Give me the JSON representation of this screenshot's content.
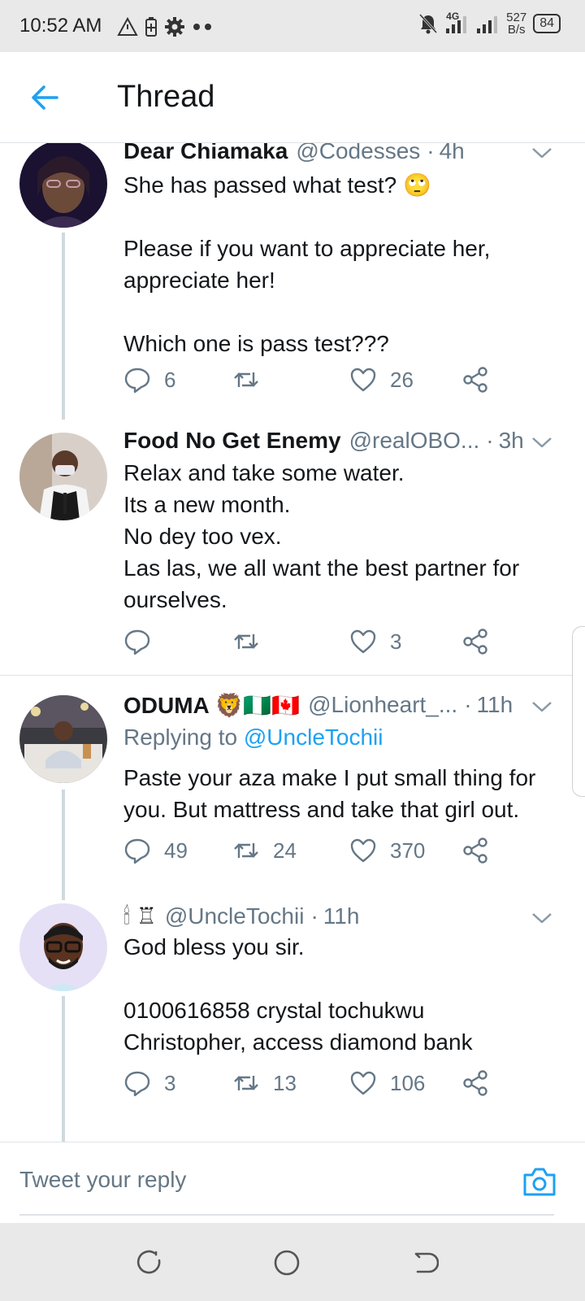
{
  "status_bar": {
    "time": "10:52 AM",
    "left_icons": [
      "alert-triangle-icon",
      "battery-saver-icon",
      "gear-icon",
      "dots-icon"
    ],
    "network": "4G",
    "speed_value": "527",
    "speed_unit": "B/s",
    "battery": "84"
  },
  "header": {
    "title": "Thread",
    "back_icon": "arrow-left-icon"
  },
  "tweets": [
    {
      "name": "Dear Chiamaka",
      "handle": "@Codesses",
      "time": "4h",
      "reply_to": "",
      "lines": [
        "She has passed what test? 🙄",
        "",
        "Please if you want to appreciate her,",
        "appreciate her!",
        "",
        "Which one is pass test???"
      ],
      "replies": "6",
      "retweets": "",
      "likes": "26"
    },
    {
      "name": "Food No Get Enemy",
      "handle": "@realOBO...",
      "time": "3h",
      "reply_to": "",
      "lines": [
        "Relax and take some water.",
        "Its a new month.",
        "No dey too vex.",
        "Las las, we all want the best partner for",
        "ourselves."
      ],
      "replies": "",
      "retweets": "",
      "likes": "3"
    },
    {
      "name": "ODUMA 🦁🇳🇬🇨🇦",
      "handle": "@Lionheart_...",
      "time": "11h",
      "reply_to_prefix": "Replying to",
      "reply_to": "@UncleTochii",
      "lines": [
        "Paste your aza make I put small thing for",
        "you. But mattress and take that girl out."
      ],
      "replies": "49",
      "retweets": "24",
      "likes": "370"
    },
    {
      "name": "🕯 ♖",
      "handle": "@UncleTochii",
      "time": "11h",
      "reply_to": "",
      "lines": [
        "God bless you sir.",
        "",
        "0100616858 crystal tochukwu",
        "Christopher, access diamond bank"
      ],
      "replies": "3",
      "retweets": "13",
      "likes": "106"
    }
  ],
  "reply_bar": {
    "placeholder": "Tweet your reply",
    "camera_icon": "camera-icon"
  },
  "nav_bar": [
    "recent-apps-icon",
    "home-icon",
    "back-icon"
  ],
  "colors": {
    "accent": "#1da1f2",
    "secondary_text": "#657786",
    "primary_text": "#14171a",
    "divider": "#dfe3e6",
    "system_bar": "#e9e9e9"
  }
}
